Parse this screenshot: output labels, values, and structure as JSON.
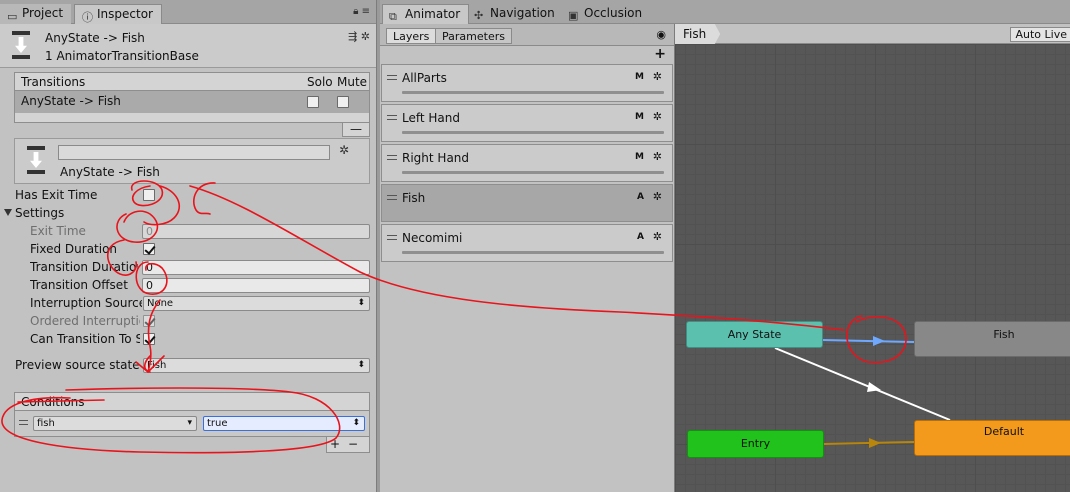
{
  "left_tabs": {
    "project": "Project",
    "inspector": "Inspector"
  },
  "inspector": {
    "title": "AnyState -> Fish",
    "subtitle": "1 AnimatorTransitionBase",
    "transitions": {
      "header": "Transitions",
      "solo": "Solo",
      "mute": "Mute",
      "rows": [
        {
          "name": "AnyState -> Fish",
          "solo": false,
          "mute": false
        }
      ],
      "minus": "—"
    },
    "transition_name": "AnyState -> Fish",
    "has_exit_time": {
      "label": "Has Exit Time",
      "checked": false
    },
    "settings": {
      "label": "Settings",
      "exit_time": {
        "label": "Exit Time",
        "value": "0"
      },
      "fixed_duration": {
        "label": "Fixed Duration",
        "checked": true
      },
      "transition_duration": {
        "label": "Transition Duration",
        "value": "0"
      },
      "transition_offset": {
        "label": "Transition Offset",
        "value": "0"
      },
      "interruption_source": {
        "label": "Interruption Source",
        "value": "None"
      },
      "ordered_interruption": {
        "label": "Ordered Interruption",
        "checked": true
      },
      "can_transition_to_self": {
        "label": "Can Transition To Self",
        "checked": true
      }
    },
    "preview_source_state": {
      "label": "Preview source state",
      "value": "Fish"
    },
    "conditions": {
      "header": "Conditions",
      "rows": [
        {
          "parameter": "fish",
          "value": "true"
        }
      ],
      "plus": "+",
      "minus": "−"
    }
  },
  "animator_tabs": {
    "animator": "Animator",
    "navigation": "Navigation",
    "occlusion": "Occlusion"
  },
  "layers_panel": {
    "tabs": {
      "layers": "Layers",
      "parameters": "Parameters"
    },
    "add": "+",
    "layers": [
      {
        "name": "AllParts",
        "badge": "M",
        "selected": false
      },
      {
        "name": "Left Hand",
        "badge": "M",
        "selected": false
      },
      {
        "name": "Right Hand",
        "badge": "M",
        "selected": false
      },
      {
        "name": "Fish",
        "badge": "A",
        "selected": true
      },
      {
        "name": "Necomimi",
        "badge": "A",
        "selected": false
      }
    ]
  },
  "graph": {
    "breadcrumb": "Fish",
    "auto_live": "Auto Live",
    "nodes": {
      "any_state": "Any State",
      "fish": "Fish",
      "entry": "Entry",
      "default": "Default"
    }
  },
  "colors": {
    "any_state": "#5cc0ae",
    "entry": "#21c21b",
    "default": "#f39a1d",
    "state": "#888888",
    "selected_transition": "#6fa8ff",
    "annotation": "#e8141c"
  }
}
